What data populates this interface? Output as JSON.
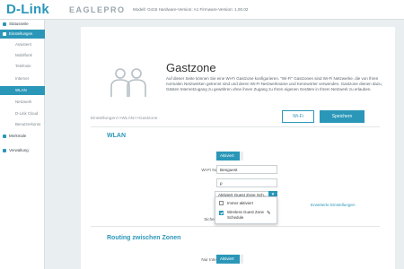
{
  "header": {
    "logo": "D-Link",
    "product": "EAGLEPRO",
    "model_info": "Modell: G415 Hardware-Version: A1 Firmware-Version: 1.00.02"
  },
  "sidebar": {
    "items": [
      {
        "label": "Statusseite",
        "type": "main"
      },
      {
        "label": "Einstellungen",
        "type": "main-active"
      },
      {
        "label": "Assistent",
        "type": "sub"
      },
      {
        "label": "Mobilfunk",
        "type": "sub"
      },
      {
        "label": "Telefonie",
        "type": "sub"
      },
      {
        "label": "Internet",
        "type": "sub"
      },
      {
        "label": "WLAN",
        "type": "sub-active"
      },
      {
        "label": "Netzwerk",
        "type": "sub"
      },
      {
        "label": "D-Link Cloud",
        "type": "sub"
      },
      {
        "label": "Benutzerkonto",
        "type": "sub"
      },
      {
        "label": "Merkmale",
        "type": "main"
      },
      {
        "label": "Verwaltung",
        "type": "main"
      }
    ]
  },
  "page": {
    "title": "Gastzone",
    "description": "Auf dieser Seite können Sie eine Wi-Fi Gastzone konfigurieren. \"Wi-Fi\" Gastzonen sind Wi-Fi Netzwerke, die von Ihren normalen Netzwerken getrennt sind und deren Wi-Fi-Netzwerkname und Kennwörter verwenden. Gastzone dienen dazu, Gästen Internetzugang zu gewähren ohne ihnen Zugang zu Ihren eigenen Geräten in Ihrem Netzwerk zu erlauben.",
    "breadcrumb": "Einstellungen>>WLAN>>Gastzone",
    "wlan_button": "Wi-Fi",
    "save_button": "Speichern"
  },
  "wlan_section": {
    "title": "WLAN",
    "status_label": "Status:",
    "status_value": "Aktiviert",
    "ssid_label": "Wi-Fi Name (SSID):",
    "ssid_value": "Benguest",
    "password_label": "Kennwort:",
    "password_value": "p",
    "zone_label": "Zonen:",
    "zone_value": "Aktiviert Guest Zone Sch...",
    "advanced_link": "Erweiterte Einstellungen",
    "security_label": "Sicherheitsmodus:",
    "dropdown": {
      "options": [
        {
          "label": "Immer aktiviert",
          "checked": false
        },
        {
          "label": "Wireless Guest Zone Schedule",
          "checked": true
        }
      ]
    }
  },
  "routing_section": {
    "title": "Routing zwischen Zonen",
    "internet_only_label": "Nur Internetzugang:",
    "internet_only_value": "Aktiviert"
  },
  "colors": {
    "accent": "#2b97b8",
    "background": "#e9eef1"
  }
}
